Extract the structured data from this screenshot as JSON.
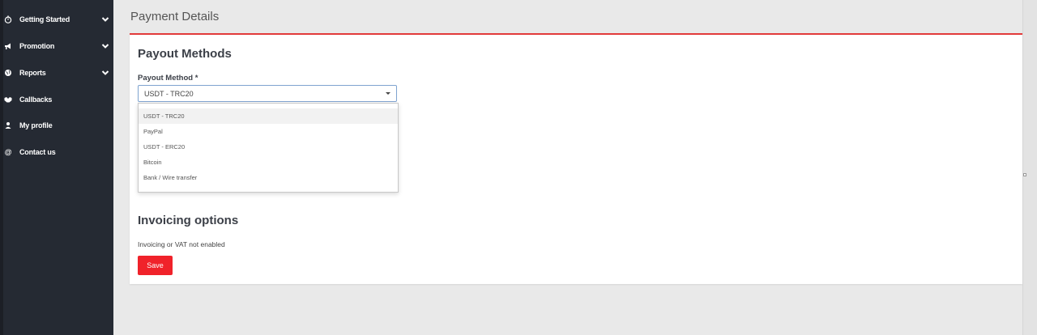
{
  "sidebar": {
    "items": [
      {
        "label": "Getting Started",
        "icon": "stopwatch-icon",
        "has_chevron": true
      },
      {
        "label": "Promotion",
        "icon": "megaphone-icon",
        "has_chevron": true
      },
      {
        "label": "Reports",
        "icon": "globe-icon",
        "has_chevron": true
      },
      {
        "label": "Callbacks",
        "icon": "handshake-icon",
        "has_chevron": false
      },
      {
        "label": "My profile",
        "icon": "user-icon",
        "has_chevron": false
      },
      {
        "label": "Contact us",
        "icon": "at-icon",
        "has_chevron": false
      }
    ]
  },
  "header": {
    "title": "Payment Details"
  },
  "payout": {
    "section_title": "Payout Methods",
    "field_label": "Payout Method *",
    "selected_value": "USDT - TRC20",
    "options": [
      "USDT - TRC20",
      "PayPal",
      "USDT - ERC20",
      "Bitcoin",
      "Bank / Wire transfer"
    ]
  },
  "invoicing": {
    "section_title": "Invoicing options",
    "status_text": "Invoicing or VAT not enabled"
  },
  "actions": {
    "save_label": "Save"
  },
  "colors": {
    "sidebar_bg": "#252a33",
    "accent": "#e23a3a",
    "save_button": "#f0222a"
  }
}
